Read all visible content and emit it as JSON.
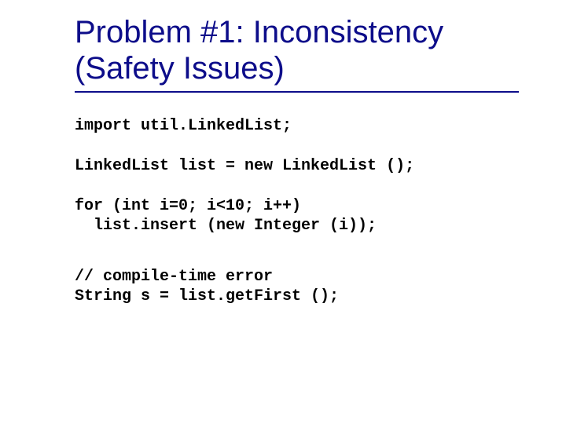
{
  "title_line1": "Problem #1: Inconsistency",
  "title_line2": "(Safety Issues)",
  "code": {
    "block1": "import util.LinkedList;",
    "block2": "LinkedList list = new LinkedList ();",
    "block3_line1": "for (int i=0; i<10; i++)",
    "block3_line2": "  list.insert (new Integer (i));",
    "block4_line1": "// compile-time error",
    "block4_line2": "String s = list.getFirst ();"
  }
}
